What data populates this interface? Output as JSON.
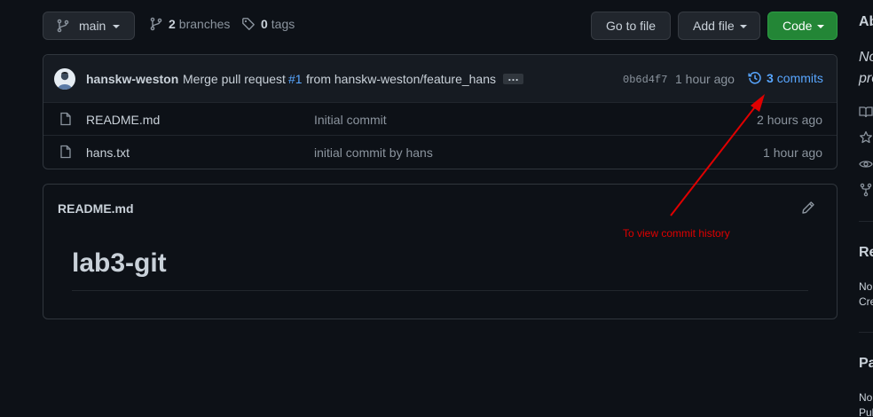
{
  "toolbar": {
    "branch_label": "main",
    "branches_count": "2",
    "branches_label": "branches",
    "tags_count": "0",
    "tags_label": "tags",
    "goto_file_label": "Go to file",
    "add_file_label": "Add file",
    "code_label": "Code"
  },
  "latest_commit": {
    "author": "hanskw-weston",
    "message_prefix": "Merge pull request",
    "pr_link": "#1",
    "message_suffix": "from hanskw-weston/feature_hans",
    "ellipsis": "…",
    "sha": "0b6d4f7",
    "time": "1 hour ago",
    "commits_count": "3",
    "commits_label": "commits"
  },
  "files": [
    {
      "name": "README.md",
      "message": "Initial commit",
      "time": "2 hours ago"
    },
    {
      "name": "hans.txt",
      "message": "initial commit by hans",
      "time": "1 hour ago"
    }
  ],
  "readme": {
    "title": "README.md",
    "heading": "lab3-git"
  },
  "annotation": {
    "text": "To view commit history",
    "color": "#e00000"
  },
  "sidebar": {
    "about_heading": "Ab",
    "about_desc_1": "No",
    "about_desc_2": "pro",
    "releases_heading": "Re",
    "releases_none": "No",
    "releases_link": "Cre",
    "packages_heading": "Pa",
    "packages_none": "No",
    "packages_link": "Pul"
  },
  "colors": {
    "background": "#0d1117",
    "link": "#58a6ff",
    "green_button": "#238636"
  }
}
